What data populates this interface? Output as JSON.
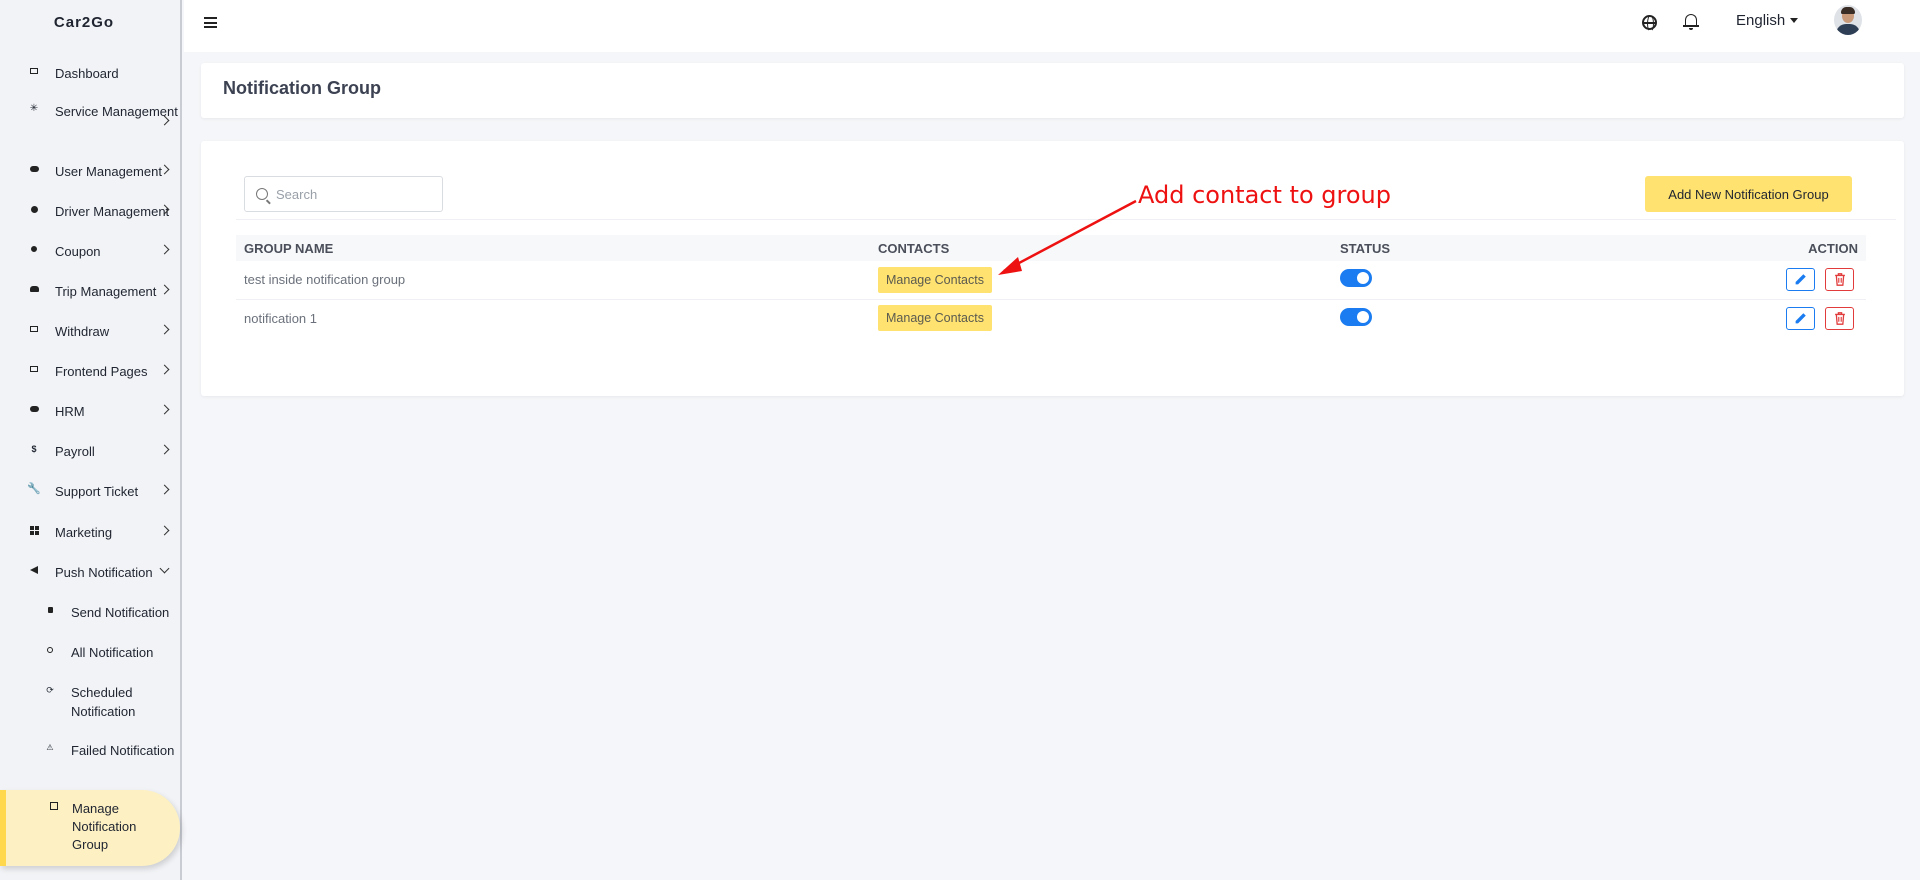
{
  "app": {
    "brand": "Car2Go"
  },
  "sidebar": {
    "items": [
      {
        "label": "Dashboard"
      },
      {
        "label": "Service Management"
      },
      {
        "label": "User Management"
      },
      {
        "label": "Driver Management"
      },
      {
        "label": "Coupon"
      },
      {
        "label": "Trip Management"
      },
      {
        "label": "Withdraw"
      },
      {
        "label": "Frontend Pages"
      },
      {
        "label": "HRM"
      },
      {
        "label": "Payroll"
      },
      {
        "label": "Support Ticket"
      },
      {
        "label": "Marketing"
      },
      {
        "label": "Push Notification"
      }
    ],
    "subitems": [
      {
        "label": "Send Notification"
      },
      {
        "label": "All Notification"
      },
      {
        "label": "Scheduled Notification"
      },
      {
        "label": "Failed Notification"
      },
      {
        "label": "Manage Notification Group"
      }
    ]
  },
  "topbar": {
    "language": "English"
  },
  "page": {
    "title": "Notification Group"
  },
  "toolbar": {
    "search_placeholder": "Search",
    "add_label": "Add New Notification Group"
  },
  "table": {
    "headers": [
      "GROUP NAME",
      "CONTACTS",
      "STATUS",
      "ACTION"
    ],
    "rows": [
      {
        "group_name": "test inside notification group",
        "contacts_label": "Manage Contacts",
        "status_on": true
      },
      {
        "group_name": "notification 1",
        "contacts_label": "Manage Contacts",
        "status_on": true
      }
    ]
  },
  "annotation": {
    "text": "Add contact to group",
    "color": "#ee1111"
  },
  "colors": {
    "accent": "#ffe270",
    "primary": "#1a7cf0",
    "danger": "#e23b3b"
  }
}
